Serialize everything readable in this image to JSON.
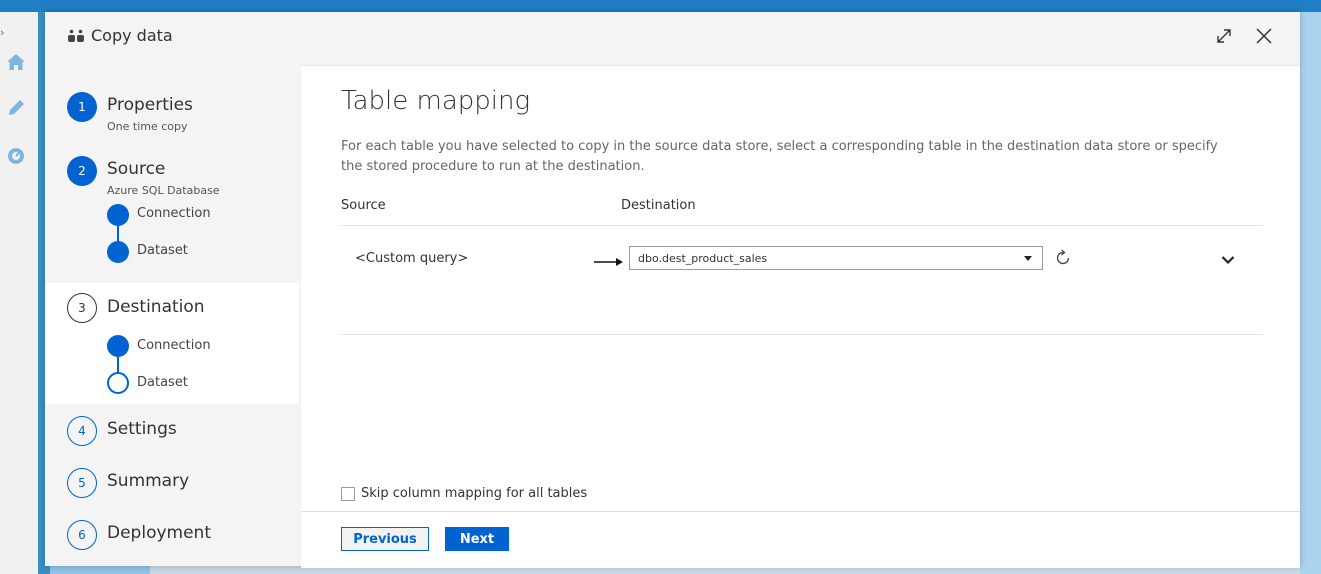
{
  "dialog": {
    "title": "Copy data",
    "icon": "copy-data-icon",
    "header_icons": [
      "maximize-icon",
      "close-icon"
    ]
  },
  "steps": [
    {
      "number": "1",
      "title": "Properties",
      "subtitle": "One time copy",
      "state": "done"
    },
    {
      "number": "2",
      "title": "Source",
      "subtitle": "Azure SQL Database",
      "state": "done",
      "substeps": [
        {
          "label": "Connection",
          "state": "done"
        },
        {
          "label": "Dataset",
          "state": "done"
        }
      ]
    },
    {
      "number": "3",
      "title": "Destination",
      "subtitle": "",
      "state": "active",
      "substeps": [
        {
          "label": "Connection",
          "state": "done"
        },
        {
          "label": "Dataset",
          "state": "current"
        }
      ]
    },
    {
      "number": "4",
      "title": "Settings",
      "state": "pending"
    },
    {
      "number": "5",
      "title": "Summary",
      "state": "pending"
    },
    {
      "number": "6",
      "title": "Deployment",
      "state": "pending"
    }
  ],
  "main": {
    "title": "Table mapping",
    "description": "For each table you have selected to copy in the source data store, select a corresponding table in the destination data store or specify the stored procedure to run at the destination.",
    "columns": {
      "source": "Source",
      "destination": "Destination"
    },
    "rows": [
      {
        "source": "<Custom query>",
        "destination": "dbo.dest_product_sales"
      }
    ],
    "skip_mapping_label": "Skip column mapping for all tables",
    "skip_mapping_checked": false
  },
  "footer": {
    "previous_label": "Previous",
    "next_label": "Next"
  },
  "colors": {
    "accent": "#0063d1",
    "panel": "#f4f4f4",
    "active_step": "#ffffff"
  }
}
